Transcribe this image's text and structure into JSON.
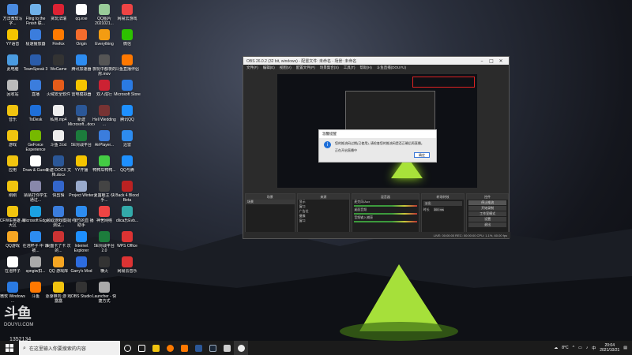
{
  "desktop": {
    "icons": [
      {
        "label": "方法微软写字...",
        "color": "#4a8be0",
        "icon": "app-icon"
      },
      {
        "label": "Fling to the Finish 联...",
        "color": "#6fb1ea",
        "icon": "game-icon"
      },
      {
        "label": "贪玩法瑞",
        "color": "#d23",
        "icon": "game-icon"
      },
      {
        "label": "qq.exe",
        "color": "#fff",
        "icon": "file-icon"
      },
      {
        "label": "QQ图片 2021021...",
        "color": "#9c9",
        "icon": "image-icon"
      },
      {
        "label": "网易云游戏",
        "color": "#e44",
        "icon": "cloud-game-icon"
      },
      {
        "label": "YY语音",
        "color": "#f5c400",
        "icon": "yy-icon"
      },
      {
        "label": "极速播放器",
        "color": "#3b7ddd",
        "icon": "player-icon"
      },
      {
        "label": "Firefox",
        "color": "#ff7a00",
        "icon": "firefox-icon"
      },
      {
        "label": "Origin",
        "color": "#f56c2d",
        "icon": "origin-icon"
      },
      {
        "label": "Everything",
        "color": "#f39c12",
        "icon": "search-app-icon"
      },
      {
        "label": "微信",
        "color": "#2dc100",
        "icon": "wechat-icon"
      },
      {
        "label": "此电脑",
        "color": "#4a9be0",
        "icon": "computer-icon"
      },
      {
        "label": "TeamSpeak 3",
        "color": "#2a5caa",
        "icon": "teamspeak-icon"
      },
      {
        "label": "WeGame",
        "color": "#333",
        "icon": "wegame-icon"
      },
      {
        "label": "腾讯加速器",
        "color": "#2d8cf0",
        "icon": "accelerator-icon"
      },
      {
        "label": "夜玩中都夜的房.mov",
        "color": "#555",
        "icon": "video-file-icon"
      },
      {
        "label": "斗鱼直播伴侣",
        "color": "#ff7800",
        "icon": "douyu-icon"
      },
      {
        "label": "回收站",
        "color": "#bbb",
        "icon": "recycle-bin-icon"
      },
      {
        "label": "直播",
        "color": "#3b7ddd",
        "icon": "live-icon"
      },
      {
        "label": "火绒安全软件",
        "color": "#e65c1a",
        "icon": "security-icon"
      },
      {
        "label": "雷电模拟器",
        "color": "#f5c400",
        "icon": "emulator-icon"
      },
      {
        "label": "双人成行",
        "color": "#c23",
        "icon": "game-icon"
      },
      {
        "label": "Microsoft Store",
        "color": "#2a7ae2",
        "icon": "store-icon"
      },
      {
        "label": "音乐",
        "color": "#f1c40f",
        "icon": "music-icon"
      },
      {
        "label": "ToDesk",
        "color": "#1e6fd9",
        "icon": "todesk-icon"
      },
      {
        "label": "私用.mp4",
        "color": "#eee",
        "icon": "video-file-icon"
      },
      {
        "label": "新建 Microsoft...docx",
        "color": "#2b5797",
        "icon": "word-icon"
      },
      {
        "label": "Hell Wedding ...",
        "color": "#733",
        "icon": "game-icon"
      },
      {
        "label": "腾讯QQ",
        "color": "#1e90ff",
        "icon": "qq-icon"
      },
      {
        "label": "游戏",
        "color": "#f1c40f",
        "icon": "folder-icon"
      },
      {
        "label": "GeForce Experience",
        "color": "#76b900",
        "icon": "geforce-icon"
      },
      {
        "label": "斗鱼 3.txt",
        "color": "#eee",
        "icon": "text-file-icon"
      },
      {
        "label": "5E对战平台",
        "color": "#1c7c3c",
        "icon": "game-platform-icon"
      },
      {
        "label": "AirPlayer...",
        "color": "#3b7ddd",
        "icon": "airplay-icon"
      },
      {
        "label": "迅雷",
        "color": "#2d8cf0",
        "icon": "thunder-icon"
      },
      {
        "label": "应用",
        "color": "#f1c40f",
        "icon": "folder-icon"
      },
      {
        "label": "Draw & Guess",
        "color": "#fff",
        "icon": "game-icon"
      },
      {
        "label": "新建 DOCX 文档.docx",
        "color": "#2b5797",
        "icon": "word-icon"
      },
      {
        "label": "YY开播",
        "color": "#f5c400",
        "icon": "yy-icon"
      },
      {
        "label": "鸭鸭车鸭鸭...",
        "color": "#4c4",
        "icon": "game-icon"
      },
      {
        "label": "QQ与腾",
        "color": "#1e90ff",
        "icon": "qq-icon"
      },
      {
        "label": "刚刚",
        "color": "#f1c40f",
        "icon": "folder-icon"
      },
      {
        "label": "猜猜打你学生 通过...",
        "color": "#88a",
        "icon": "game-icon"
      },
      {
        "label": "快剪辑",
        "color": "#36c",
        "icon": "editor-icon"
      },
      {
        "label": "Project Winter",
        "color": "#9ac",
        "icon": "game-icon"
      },
      {
        "label": "夏露眼主·快手...",
        "color": "#444",
        "icon": "app-icon"
      },
      {
        "label": "Back 4 Blood Beta",
        "color": "#b22",
        "icon": "game-icon"
      },
      {
        "label": "CF/WE英雄 战大区",
        "color": "#f1c40f",
        "icon": "game-icon"
      },
      {
        "label": "Microsoft Edge",
        "color": "#1ba1e2",
        "icon": "edge-icon"
      },
      {
        "label": "领取游戏模拟测试...",
        "color": "#3b7ddd",
        "icon": "app-icon"
      },
      {
        "label": "小咖竹的直 播助手",
        "color": "#2d8cf0",
        "icon": "app-icon"
      },
      {
        "label": "神舍网络",
        "color": "#e44",
        "icon": "app-icon"
      },
      {
        "label": "dlica乐Evb...",
        "color": "#3aa",
        "icon": "app-icon"
      },
      {
        "label": "QQ游戏",
        "color": "#f5a623",
        "icon": "qq-game-icon"
      },
      {
        "label": "在泡杯子 中 谁被...",
        "color": "#2d8cf0",
        "icon": "app-icon"
      },
      {
        "label": "桌面卡了卡 次的...",
        "color": "#c33",
        "icon": "app-icon"
      },
      {
        "label": "Internet Explorer",
        "color": "#1e90ff",
        "icon": "ie-icon"
      },
      {
        "label": "5E对战平台 2.0",
        "color": "#1c7c3c",
        "icon": "game-platform-icon"
      },
      {
        "label": "WPS Office",
        "color": "#d33",
        "icon": "wps-icon"
      },
      {
        "label": "在泡杯子",
        "color": "#fff",
        "icon": "app-icon"
      },
      {
        "label": "spngiw扣...",
        "color": "#aaa",
        "icon": "app-icon"
      },
      {
        "label": "QQ 游戏库",
        "color": "#f5a623",
        "icon": "qq-game-icon"
      },
      {
        "label": "Garry's Mod",
        "color": "#2d6cdf",
        "icon": "game-icon"
      },
      {
        "label": "横火",
        "color": "#333",
        "icon": "game-icon"
      },
      {
        "label": "网易云音乐",
        "color": "#d33",
        "icon": "music-icon"
      },
      {
        "label": "微软 Windows ...",
        "color": "#2a7ae2",
        "icon": "windows-icon"
      },
      {
        "label": "斗鱼",
        "color": "#ff7800",
        "icon": "douyu-icon"
      },
      {
        "label": "逐渐推向 游 戏露露",
        "color": "#f1c40f",
        "icon": "folder-icon"
      },
      {
        "label": "OBS Studio",
        "color": "#333",
        "icon": "obs-icon"
      },
      {
        "label": "Launcher - 快捷方式",
        "color": "#aaa",
        "icon": "launcher-icon"
      }
    ]
  },
  "obs": {
    "title": "OBS 26.0.2 (32 bit, windows) - 配置文件: 未命名 - 场景: 未命名",
    "menu": [
      "文件(F)",
      "编辑(E)",
      "视图(V)",
      "配置文件(P)",
      "场景集合(S)",
      "工具(T)",
      "帮助(H)",
      "斗鱼直播(DOUYU)"
    ],
    "dialog": {
      "title": "温馨提醒",
      "text1": "您的推流码过期(已使用), 请检查您的推流码是否正确后再直播。",
      "text2": "正在开启直播中",
      "button": "确定"
    },
    "docks": {
      "scenes": {
        "title": "场景",
        "items": [
          "场景"
        ]
      },
      "sources": {
        "title": "来源",
        "items": [
          "显示",
          "窗口",
          "广告位",
          "摄像",
          "窗口"
        ]
      },
      "mixer": {
        "title": "混音器",
        "items": [
          "麦克风/Aux",
          "桌面音频",
          "音频输入捕获"
        ]
      },
      "transitions": {
        "title": "转场特效",
        "fade": "淡出",
        "duration_label": "时长",
        "duration": "300 ms"
      },
      "controls": {
        "title": "控件",
        "buttons": [
          "停止推流",
          "开始录制",
          "工作室模式",
          "设置",
          "退出"
        ]
      }
    },
    "status": "LIVE: 00:00:00   REC: 00:00:00   CPU: 1.1%, 60.00 fps"
  },
  "watermark": {
    "logo": "斗鱼",
    "text": "DOUYU.COM",
    "room": "1352134"
  },
  "taskbar": {
    "search_placeholder": "在这里输入你要搜索的内容",
    "weather": "8°C",
    "input_method": "中",
    "time": "20:04",
    "date": "2021/10/21"
  }
}
